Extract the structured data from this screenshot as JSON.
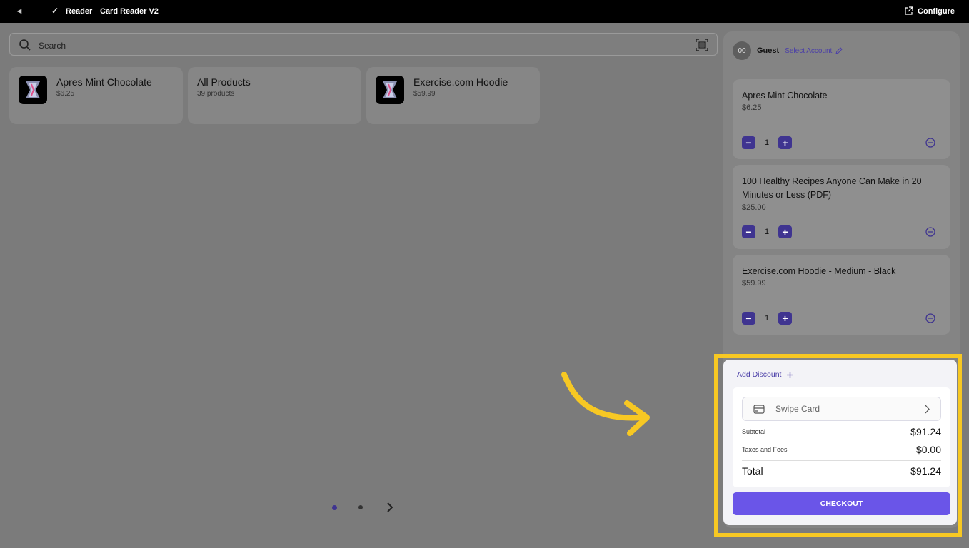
{
  "topbar": {
    "back": "◂",
    "check": "✓",
    "reader": "Reader",
    "device": "Card Reader V2",
    "configure": "Configure"
  },
  "search": {
    "placeholder": "Search"
  },
  "tiles": [
    {
      "name": "Apres Mint Chocolate",
      "sub": "$6.25"
    },
    {
      "name": "All Products",
      "sub": "39 products"
    },
    {
      "name": "Exercise.com Hoodie",
      "sub": "$59.99"
    }
  ],
  "pager": {
    "current_page": 1,
    "total_pages": 2
  },
  "account": {
    "initials": "00",
    "name": "Guest",
    "select_label": "Select Account"
  },
  "cart": [
    {
      "name": "Apres Mint Chocolate",
      "price": "$6.25",
      "qty": "1"
    },
    {
      "name": "100 Healthy Recipes Anyone Can Make in 20 Minutes or Less (PDF)",
      "price": "$25.00",
      "qty": "1"
    },
    {
      "name": "Exercise.com Hoodie - Medium - Black",
      "price": "$59.99",
      "qty": "1"
    }
  ],
  "summary": {
    "add_discount": "Add Discount",
    "swipe_card": "Swipe Card",
    "subtotal_label": "Subtotal",
    "subtotal": "$91.24",
    "taxes_label": "Taxes and Fees",
    "taxes": "$0.00",
    "total_label": "Total",
    "total": "$91.24",
    "checkout": "CHECKOUT"
  },
  "colors": {
    "accent": "#6a55e8",
    "qty_button": "#3f3490",
    "highlight": "#f7c823",
    "link": "#4b3fa8"
  }
}
